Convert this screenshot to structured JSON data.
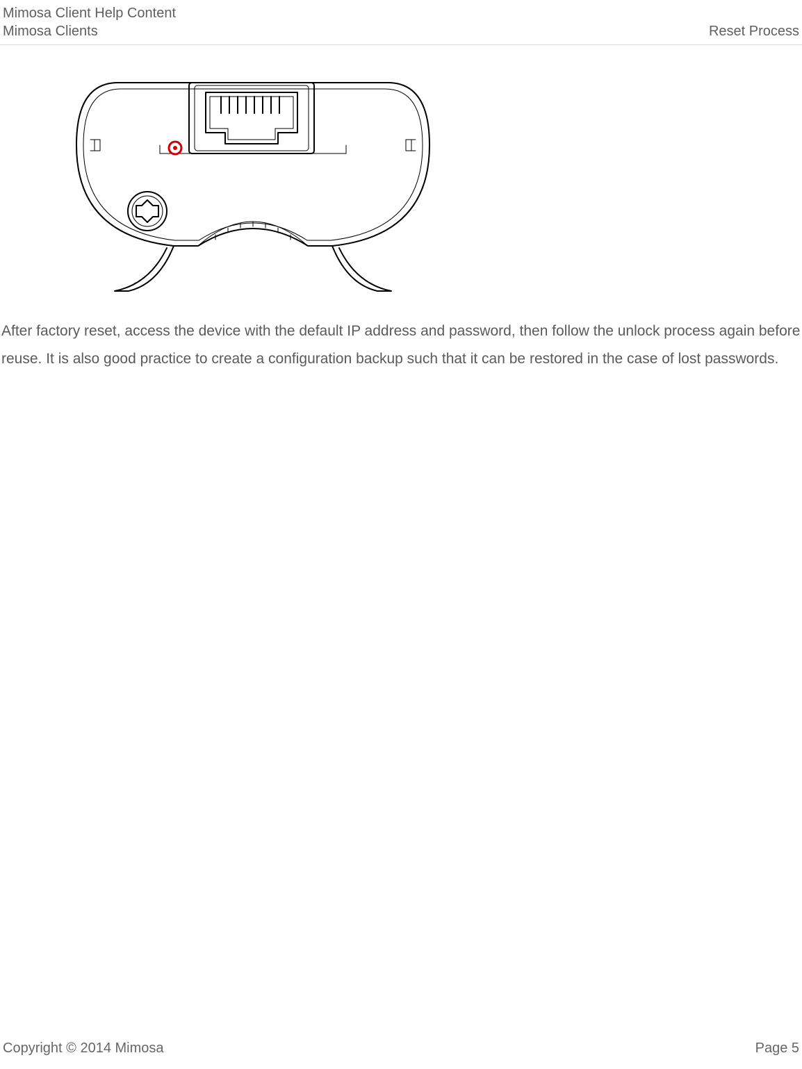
{
  "header": {
    "title_line1": "Mimosa Client Help Content",
    "title_line2": "Mimosa Clients",
    "right_label": "Reset Process"
  },
  "body": {
    "paragraph": "After factory reset, access the device with the default IP address and password, then follow the unlock process again before reuse. It is also good practice to create a configuration backup such that it can be restored in the case of lost passwords."
  },
  "figure": {
    "name": "device-bottom-reset-diagram"
  },
  "footer": {
    "copyright": "Copyright © 2014 Mimosa",
    "page_label": "Page 5"
  }
}
